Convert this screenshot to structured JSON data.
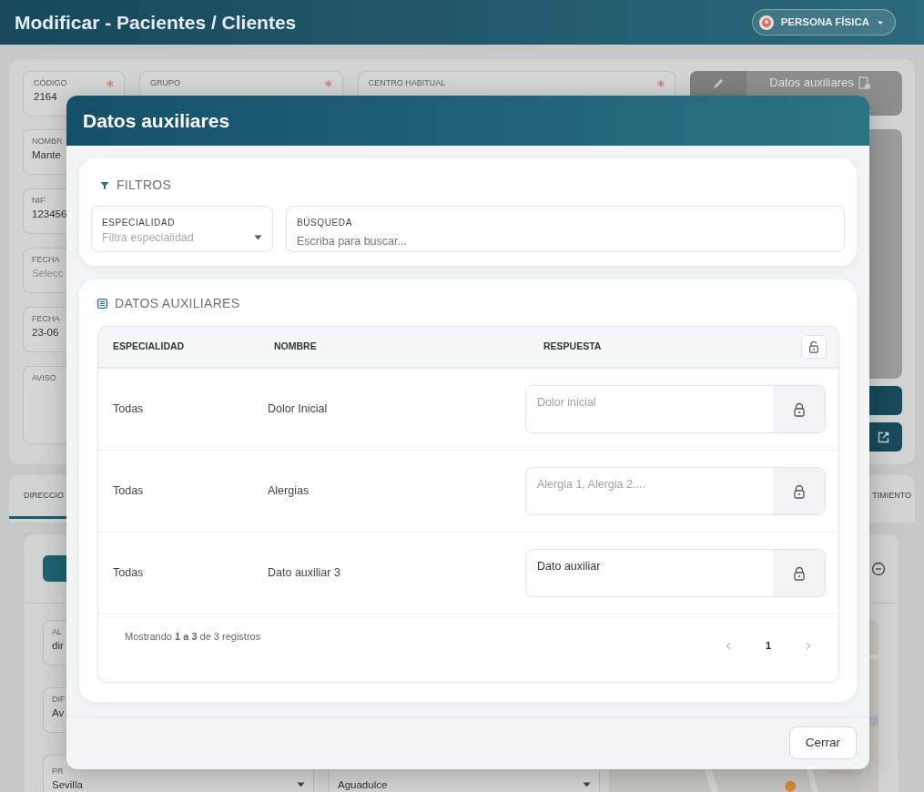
{
  "page": {
    "title": "Modificar - Pacientes / Clientes",
    "person_type": "PERSONA FÍSICA"
  },
  "form_fields": [
    {
      "label": "CÓDIGO",
      "value": "2164",
      "required": true
    },
    {
      "label": "GRUPO",
      "required": true
    },
    {
      "label": "CENTRO HABITUAL",
      "required": true
    }
  ],
  "aux_button": "Datos auxiliares",
  "left_fields": [
    {
      "label": "NOMBR",
      "value": "Mante"
    },
    {
      "label": "NIF",
      "value": "123456"
    },
    {
      "label": "FECHA",
      "placeholder": "Selecc"
    },
    {
      "label": "FECHA",
      "value": "23-06"
    },
    {
      "label": "AVISO"
    }
  ],
  "tabs": [
    {
      "label": "DIRECCIO",
      "selected": true
    },
    {
      "label": "TIMIENTO",
      "selected": false
    }
  ],
  "address_fields": [
    {
      "label": "AL",
      "value": "dir"
    },
    {
      "label": "DIF",
      "value": "Av"
    }
  ],
  "selects": [
    {
      "label": "PR",
      "value": "Sevilla"
    },
    {
      "value": "Aguadulce"
    }
  ],
  "modal": {
    "title": "Datos auxiliares",
    "filters": {
      "title": "FILTROS",
      "especialidad": {
        "label": "ESPECIALIDAD",
        "placeholder": "Filtra especialidad"
      },
      "search": {
        "label": "BÚSQUEDA",
        "placeholder": "Escriba para buscar..."
      }
    },
    "section_title": "DATOS AUXILIARES",
    "table": {
      "columns": [
        "ESPECIALIDAD",
        "NOMBRE",
        "RESPUESTA"
      ],
      "header_lock": {
        "locked": false
      },
      "rows": [
        {
          "especialidad": "Todas",
          "nombre": "Dolor Inicial",
          "respuesta": {
            "placeholder": "Dolor inicial"
          },
          "locked": true
        },
        {
          "especialidad": "Todas",
          "nombre": "Alergias",
          "respuesta": {
            "placeholder": "Alergia 1, Alergia 2...."
          },
          "locked": true
        },
        {
          "especialidad": "Todas",
          "nombre": "Dato auxiliar 3",
          "respuesta": {
            "value": "Dato auxiliar"
          },
          "locked": true
        }
      ]
    },
    "info": "Mostrando **1 a 3** de 3 registros",
    "pagination": [
      {
        "label": "1",
        "selected": true
      }
    ],
    "close": "Cerrar"
  }
}
